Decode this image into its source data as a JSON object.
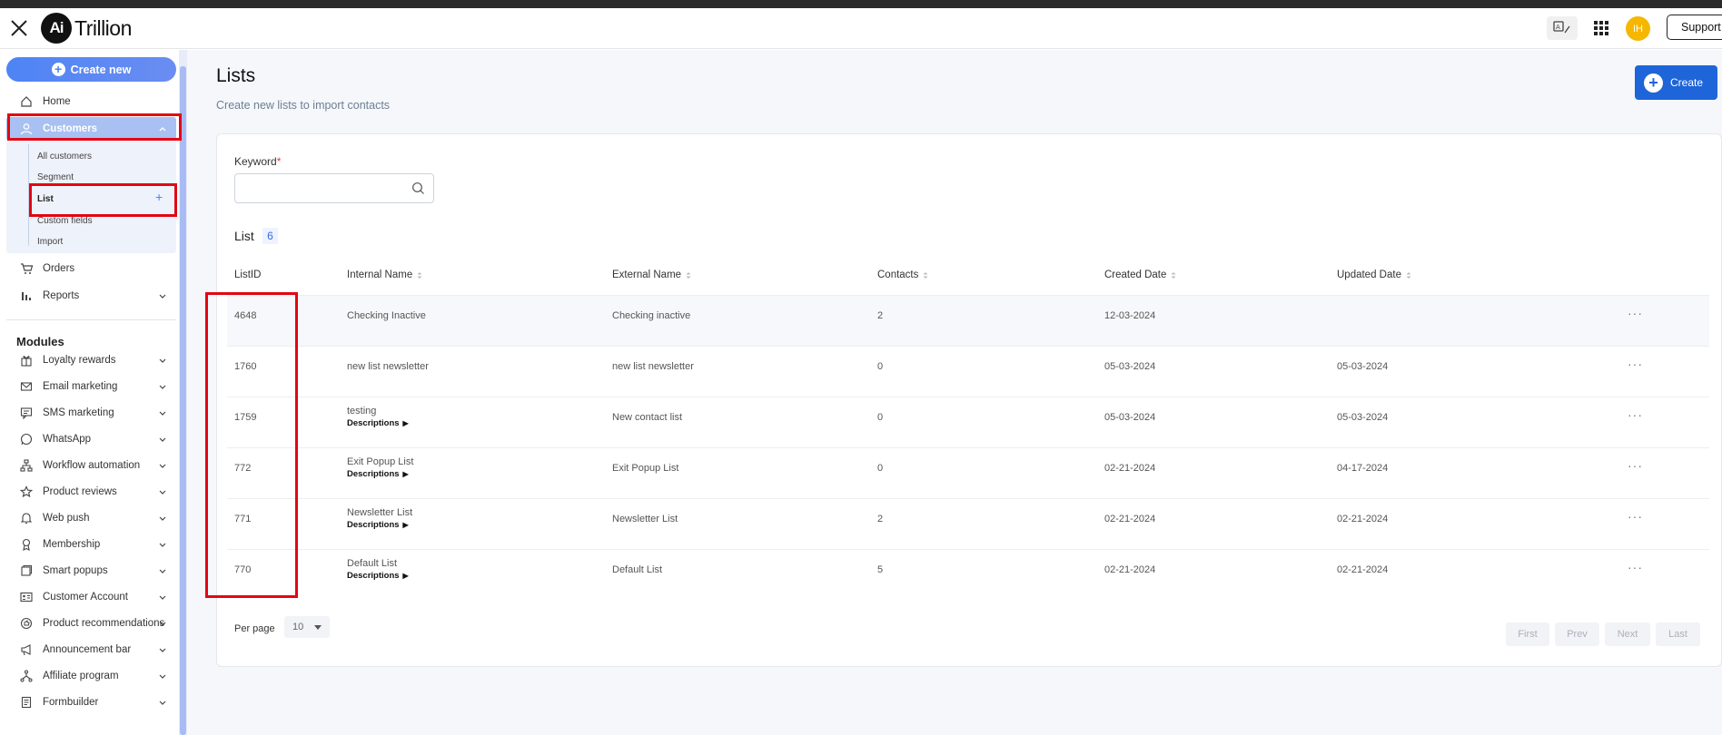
{
  "header": {
    "logo_badge": "Ai",
    "logo_text": "Trillion",
    "avatar_initials": "IH",
    "support_label": "Support"
  },
  "sidebar": {
    "create_new_label": "Create new",
    "home": "Home",
    "customers": "Customers",
    "customers_sub": [
      "All customers",
      "Segment",
      "List",
      "Custom fields",
      "Import"
    ],
    "orders": "Orders",
    "reports": "Reports",
    "modules_title": "Modules",
    "modules": [
      {
        "label": "Loyalty rewards",
        "icon": "gift-icon"
      },
      {
        "label": "Email marketing",
        "icon": "mail-icon"
      },
      {
        "label": "SMS marketing",
        "icon": "chat-icon"
      },
      {
        "label": "WhatsApp",
        "icon": "whatsapp-icon"
      },
      {
        "label": "Workflow automation",
        "icon": "workflow-icon"
      },
      {
        "label": "Product reviews",
        "icon": "star-icon"
      },
      {
        "label": "Web push",
        "icon": "bell-icon"
      },
      {
        "label": "Membership",
        "icon": "membership-icon"
      },
      {
        "label": "Smart popups",
        "icon": "popup-icon"
      },
      {
        "label": "Customer Account",
        "icon": "id-card-icon"
      },
      {
        "label": "Product recommendations",
        "icon": "recommend-icon"
      },
      {
        "label": "Announcement bar",
        "icon": "megaphone-icon"
      },
      {
        "label": "Affiliate program",
        "icon": "network-icon"
      },
      {
        "label": "Formbuilder",
        "icon": "form-icon"
      }
    ]
  },
  "main": {
    "title": "Lists",
    "subtitle": "Create new lists to import contacts",
    "create_label": "Create",
    "keyword_label": "Keyword",
    "keyword_required": "*",
    "keyword_value": "",
    "list_title": "List",
    "list_count": "6",
    "columns": [
      "ListID",
      "Internal Name",
      "External Name",
      "Contacts",
      "Created Date",
      "Updated Date"
    ],
    "rows": [
      {
        "id": "4648",
        "internal": "Checking Inactive",
        "desc": "",
        "external": "Checking inactive",
        "contacts": "2",
        "created": "12-03-2024",
        "updated": ""
      },
      {
        "id": "1760",
        "internal": "new list newsletter",
        "desc": "",
        "external": "new list newsletter",
        "contacts": "0",
        "created": "05-03-2024",
        "updated": "05-03-2024"
      },
      {
        "id": "1759",
        "internal": "testing",
        "desc": "Descriptions",
        "external": "New contact list",
        "contacts": "0",
        "created": "05-03-2024",
        "updated": "05-03-2024"
      },
      {
        "id": "772",
        "internal": "Exit Popup List",
        "desc": "Descriptions",
        "external": "Exit Popup List",
        "contacts": "0",
        "created": "02-21-2024",
        "updated": "04-17-2024"
      },
      {
        "id": "771",
        "internal": "Newsletter List",
        "desc": "Descriptions",
        "external": "Newsletter List",
        "contacts": "2",
        "created": "02-21-2024",
        "updated": "02-21-2024"
      },
      {
        "id": "770",
        "internal": "Default List",
        "desc": "Descriptions",
        "external": "Default List",
        "contacts": "5",
        "created": "02-21-2024",
        "updated": "02-21-2024"
      }
    ],
    "per_page_label": "Per page",
    "per_page_value": "10",
    "pagination": [
      "First",
      "Prev",
      "Next",
      "Last"
    ]
  },
  "colors": {
    "accent": "#1d65d8",
    "sidebar_active": "#a8c1f2",
    "annotation_red": "#e30613"
  }
}
